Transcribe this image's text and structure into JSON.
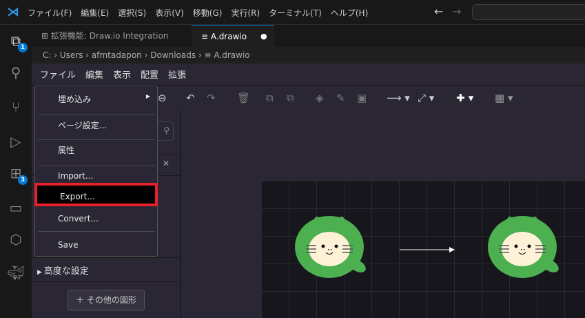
{
  "titlebar": {
    "menu": [
      "ファイル(F)",
      "編集(E)",
      "選択(S)",
      "表示(V)",
      "移動(G)",
      "実行(R)",
      "ターミナル(T)",
      "ヘルプ(H)"
    ]
  },
  "activity": {
    "explorer_badge": "1",
    "extensions_badge": "3"
  },
  "tabs": [
    {
      "label": "拡張機能: Draw.io Integration"
    },
    {
      "label": "A.drawio",
      "modified": true
    }
  ],
  "breadcrumb": [
    "C:",
    "Users",
    "afmtadapon",
    "Downloads",
    "A.drawio"
  ],
  "drawio_menu": [
    "ファイル",
    "編集",
    "表示",
    "配置",
    "拡張"
  ],
  "file_menu": {
    "items": [
      "埋め込み",
      "ページ設定...",
      "属性",
      "Import...",
      "Export...",
      "Convert...",
      "Save"
    ],
    "highlighted": "Export...",
    "highlight_color": "#e8202a"
  },
  "left_panel": {
    "advanced": "高度な設定",
    "more_shapes": "その他の図形"
  },
  "colors": {
    "accent": "#0078d4",
    "cat_green": "#4caf50",
    "cat_face": "#fdf1d6"
  }
}
